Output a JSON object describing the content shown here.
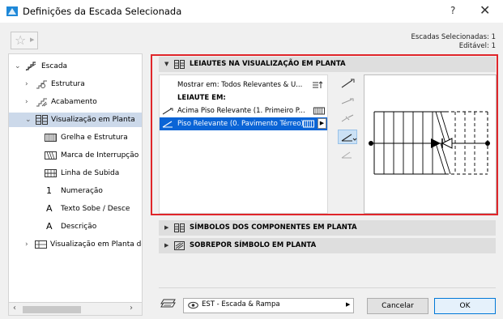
{
  "window": {
    "title": "Definições da Escada Selecionada",
    "help_label": "?",
    "close_label": "✕"
  },
  "selection_info": {
    "line1": "Escadas Selecionadas: 1",
    "line2": "Editável: 1"
  },
  "tree": {
    "items": [
      {
        "label": "Escada",
        "icon": "stair-icon",
        "expander": "⌄"
      },
      {
        "label": "Estrutura",
        "icon": "structure-icon",
        "expander": "›"
      },
      {
        "label": "Acabamento",
        "icon": "finish-icon",
        "expander": "›"
      },
      {
        "label": "Visualização em Planta",
        "icon": "floor-plan-display-icon",
        "expander": "⌄"
      },
      {
        "label": "Grelha e Estrutura",
        "icon": "grid-structure-icon"
      },
      {
        "label": "Marca de Interrupção",
        "icon": "break-mark-icon"
      },
      {
        "label": "Linha de Subida",
        "icon": "walking-line-icon"
      },
      {
        "label": "Numeração",
        "icon": "numbering-icon",
        "glyph": "1"
      },
      {
        "label": "Texto Sobe / Desce",
        "icon": "up-down-text-icon",
        "glyph": "A"
      },
      {
        "label": "Descrição",
        "icon": "description-icon",
        "glyph": "A"
      },
      {
        "label": "Visualização em Planta de T",
        "icon": "tread-plan-display-icon",
        "expander": "›"
      }
    ],
    "scroll_left": "‹",
    "scroll_right": "›"
  },
  "sections": {
    "s1": {
      "label": "LEIAUTES NA VISUALIZAÇÃO EM PLANTA",
      "arrow": "▼"
    },
    "s2": {
      "label": "SÍMBOLOS DOS COMPONENTES EM PLANTA",
      "arrow": "▶"
    },
    "s3": {
      "label": "SOBREPOR SÍMBOLO EM PLANTA",
      "arrow": "▶"
    }
  },
  "layout_list": {
    "show_on": "Mostrar em: Todos Relevantes & U...",
    "group_header": "LEIAUTE EM:",
    "item1": "Acima Piso Relevante (1. Primeiro P...",
    "item2": "Piso Relevante (0. Pavimento Térreo)",
    "item2_btn": "▶"
  },
  "footer": {
    "layer_value": "EST - Escada & Rampa",
    "layer_arrow": "▶",
    "cancel_label": "Cancelar",
    "ok_label": "OK"
  },
  "colors": {
    "highlight_border": "#e0262a",
    "selection_blue": "#0a64d6",
    "tree_selection": "#ccd9ea"
  }
}
